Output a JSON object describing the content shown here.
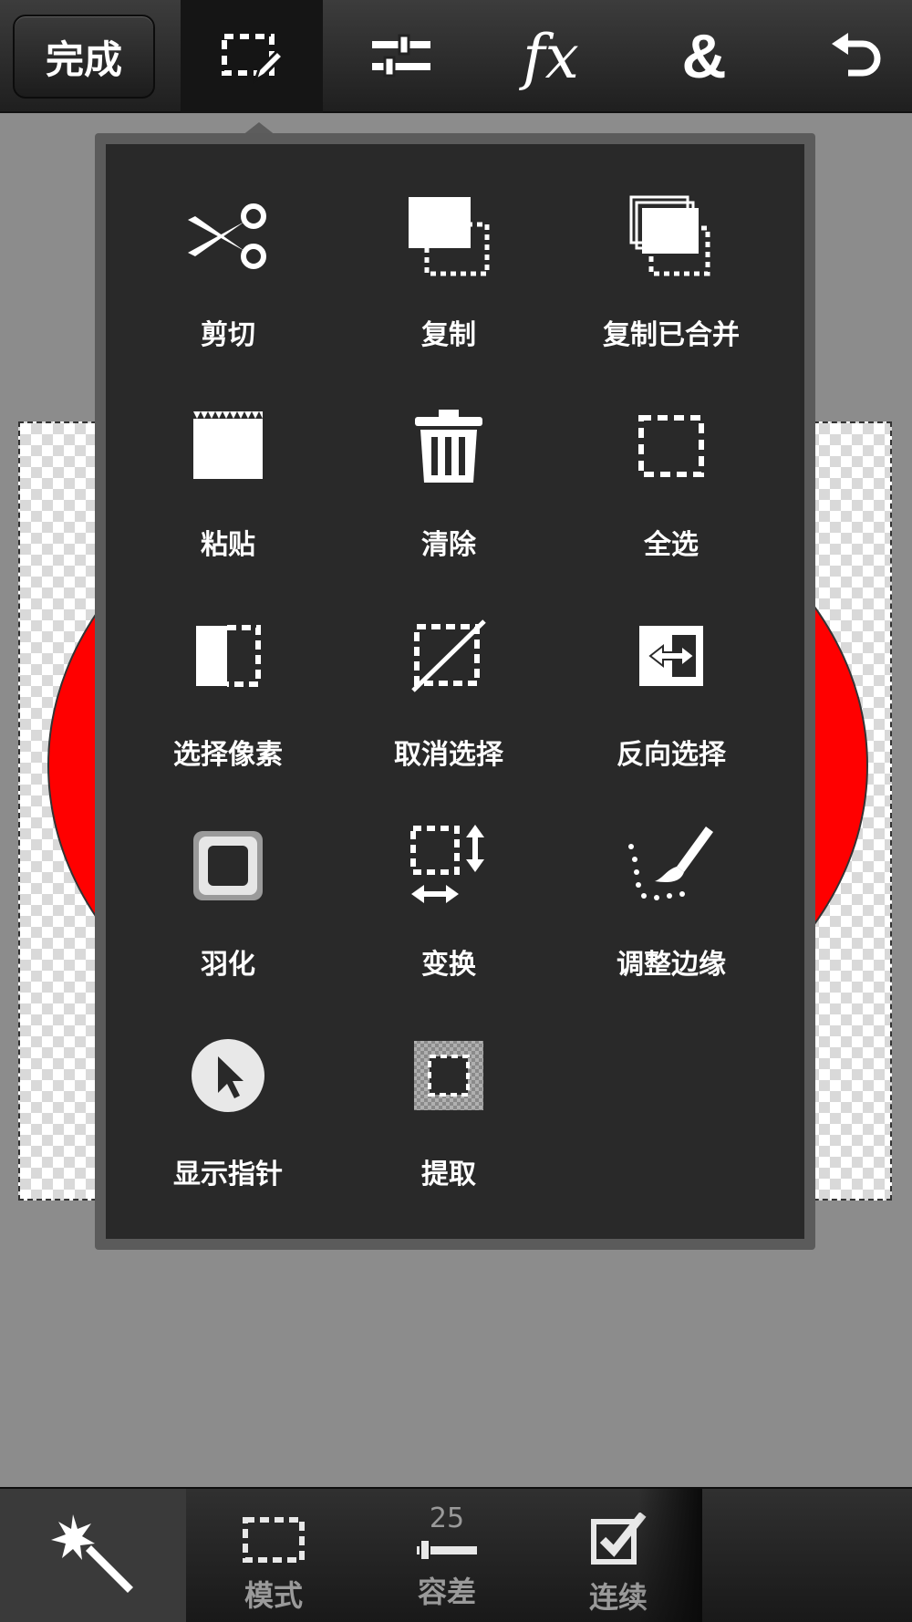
{
  "topbar": {
    "done_label": "完成",
    "tools": [
      {
        "name": "selection-edit",
        "icon": "selection-pencil-icon",
        "active": true
      },
      {
        "name": "adjustments",
        "icon": "sliders-icon"
      },
      {
        "name": "effects",
        "icon": "fx-icon",
        "text": "fx"
      },
      {
        "name": "blend",
        "icon": "ampersand-icon",
        "text": "&"
      },
      {
        "name": "undo",
        "icon": "undo-icon"
      }
    ]
  },
  "menu": {
    "items": [
      {
        "label": "剪切",
        "icon": "scissors-icon"
      },
      {
        "label": "复制",
        "icon": "copy-icon"
      },
      {
        "label": "复制已合并",
        "icon": "copy-merged-icon"
      },
      {
        "label": "粘贴",
        "icon": "paste-icon"
      },
      {
        "label": "清除",
        "icon": "trash-icon"
      },
      {
        "label": "全选",
        "icon": "select-all-icon"
      },
      {
        "label": "选择像素",
        "icon": "select-pixels-icon"
      },
      {
        "label": "取消选择",
        "icon": "deselect-icon"
      },
      {
        "label": "反向选择",
        "icon": "invert-selection-icon"
      },
      {
        "label": "羽化",
        "icon": "feather-icon"
      },
      {
        "label": "变换",
        "icon": "transform-icon"
      },
      {
        "label": "调整边缘",
        "icon": "refine-edge-icon"
      },
      {
        "label": "显示指针",
        "icon": "cursor-icon"
      },
      {
        "label": "提取",
        "icon": "extract-icon"
      }
    ]
  },
  "bottombar": {
    "magic_wand_icon": "magic-wand-icon",
    "mode_label": "模式",
    "tolerance_value": "25",
    "tolerance_label": "容差",
    "contiguous_label": "连续"
  },
  "colors": {
    "canvas_shape": "#ff0000",
    "menu_background": "#292929",
    "toolbar_background": "#1f1f1f",
    "workspace_background": "#8c8c8c"
  }
}
